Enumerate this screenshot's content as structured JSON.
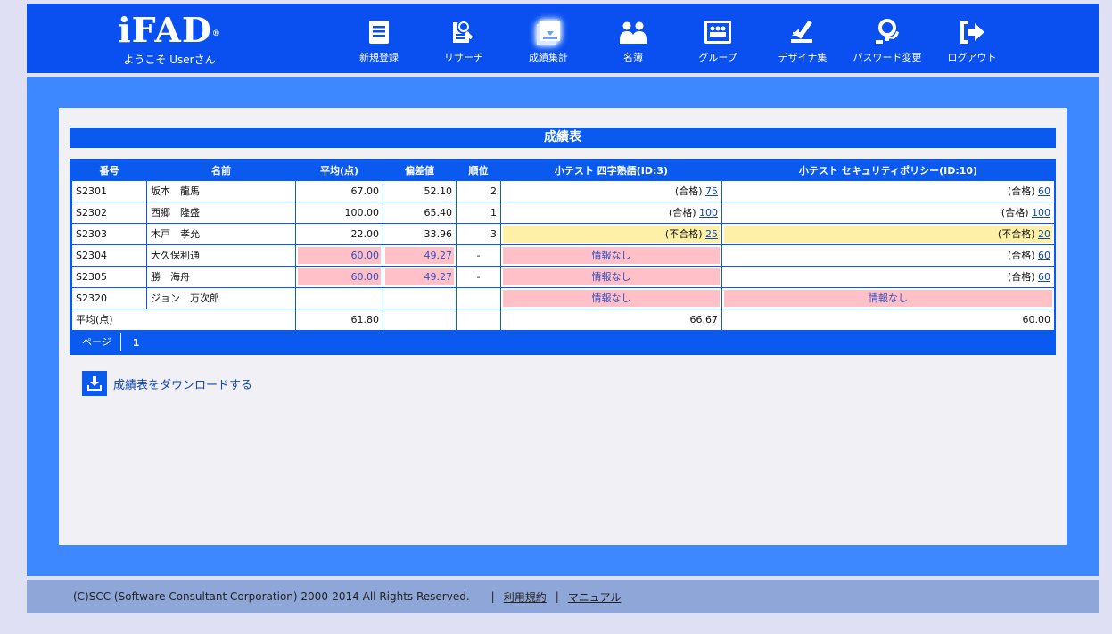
{
  "header": {
    "logo": "iFAD",
    "logo_mark": "®",
    "welcome": "ようこそ Userさん"
  },
  "nav": [
    {
      "label": "新規登録",
      "icon": "register-icon"
    },
    {
      "label": "リサーチ",
      "icon": "research-icon"
    },
    {
      "label": "成績集計",
      "icon": "grade-summary-icon",
      "active": true
    },
    {
      "label": "名簿",
      "icon": "roster-icon"
    },
    {
      "label": "グループ",
      "icon": "group-icon"
    },
    {
      "label": "デザイナ集",
      "icon": "designer-icon"
    },
    {
      "label": "パスワード変更",
      "icon": "password-icon"
    },
    {
      "label": "ログアウト",
      "icon": "logout-icon"
    }
  ],
  "table": {
    "title": "成績表",
    "headers": [
      "番号",
      "名前",
      "平均(点)",
      "偏差値",
      "順位",
      "小テスト 四字熟語(ID:3)",
      "小テスト セキュリティポリシー(ID:10)"
    ],
    "rows": [
      {
        "id": "S2301",
        "name": "坂本　龍馬",
        "avg": "67.00",
        "dev": "52.10",
        "rank": "2",
        "t1_status": "(合格)",
        "t1_score": "75",
        "t2_status": "(合格)",
        "t2_score": "60"
      },
      {
        "id": "S2302",
        "name": "西郷　隆盛",
        "avg": "100.00",
        "dev": "65.40",
        "rank": "1",
        "t1_status": "(合格)",
        "t1_score": "100",
        "t2_status": "(合格)",
        "t2_score": "100"
      },
      {
        "id": "S2303",
        "name": "木戸　孝允",
        "avg": "22.00",
        "dev": "33.96",
        "rank": "3",
        "t1_status": "(不合格)",
        "t1_score": "25",
        "t2_status": "(不合格)",
        "t2_score": "20"
      },
      {
        "id": "S2304",
        "name": "大久保利通",
        "avg": "60.00",
        "dev": "49.27",
        "rank": "-",
        "t1_none": "情報なし",
        "t2_status": "(合格)",
        "t2_score": "60"
      },
      {
        "id": "S2305",
        "name": "勝　海舟",
        "avg": "60.00",
        "dev": "49.27",
        "rank": "-",
        "t1_none": "情報なし",
        "t2_status": "(合格)",
        "t2_score": "60"
      },
      {
        "id": "S2320",
        "name": "ジョン　万次郎",
        "t1_none": "情報なし",
        "t2_none": "情報なし"
      }
    ],
    "footer_row": {
      "label": "平均(点)",
      "avg": "61.80",
      "t1_avg": "66.67",
      "t2_avg": "60.00"
    },
    "pager_label": "ページ",
    "pager_page": "1"
  },
  "download_label": "成績表をダウンロードする",
  "footer": {
    "copyright": "(C)SCC (Software Consultant Corporation) 2000-2014 All Rights Reserved.",
    "sep": "|",
    "terms": "利用規約",
    "manual": "マニュアル"
  },
  "colors": {
    "header_bg": "#0a50f0",
    "main_bg": "#3d88ff",
    "fail_highlight": "#fff0a8",
    "no_info_highlight": "#ffc0c8"
  }
}
